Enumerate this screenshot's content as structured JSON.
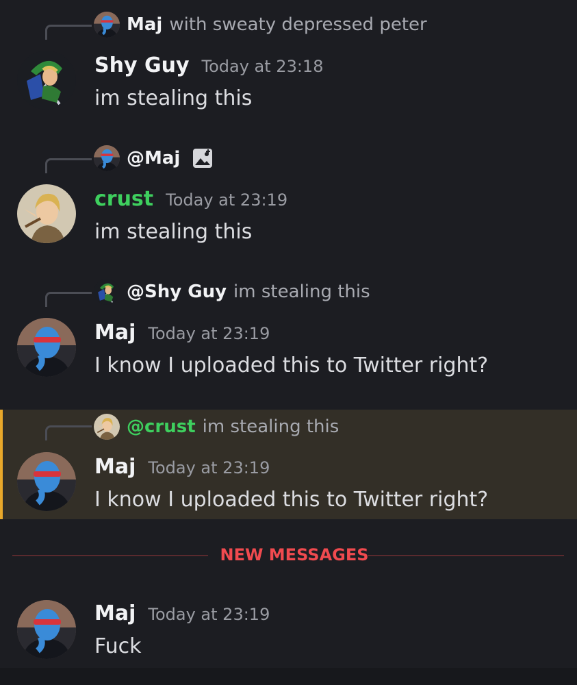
{
  "messages": [
    {
      "reply": {
        "name": "Maj",
        "text": "with sweaty depressed peter",
        "avatar": "maj-avatar"
      },
      "author": "Shy Guy",
      "time": "Today at 23:18",
      "text": "im stealing this",
      "avatar": "link-ocarina-avatar"
    },
    {
      "reply": {
        "name": "@Maj",
        "text": "",
        "avatar": "maj-avatar",
        "attachment_icon": "image-icon"
      },
      "author": "crust",
      "author_color": "#3ecf5e",
      "time": "Today at 23:19",
      "text": "im stealing this",
      "avatar": "link-botw-avatar"
    },
    {
      "reply": {
        "name": "@Shy Guy",
        "text": "im stealing this",
        "avatar": "link-ocarina-avatar"
      },
      "author": "Maj",
      "time": "Today at 23:19",
      "text": "I know I uploaded this to Twitter right?",
      "avatar": "maj-avatar"
    },
    {
      "reply": {
        "name": "@crust",
        "name_color": "#3ecf5e",
        "text": "im stealing this",
        "avatar": "link-botw-avatar"
      },
      "author": "Maj",
      "time": "Today at 23:19",
      "text": "I know I uploaded this to Twitter right?",
      "avatar": "maj-avatar",
      "highlighted": true
    },
    {
      "author": "Maj",
      "time": "Today at 23:19",
      "text": "Fuck",
      "avatar": "maj-avatar"
    }
  ],
  "divider": {
    "label": "NEW MESSAGES",
    "color": "#f04a4f"
  },
  "colors": {
    "background": "#1c1d22",
    "highlight": "#332f27",
    "highlight_bar": "#e9a82a",
    "green_name": "#3ecf5e"
  }
}
